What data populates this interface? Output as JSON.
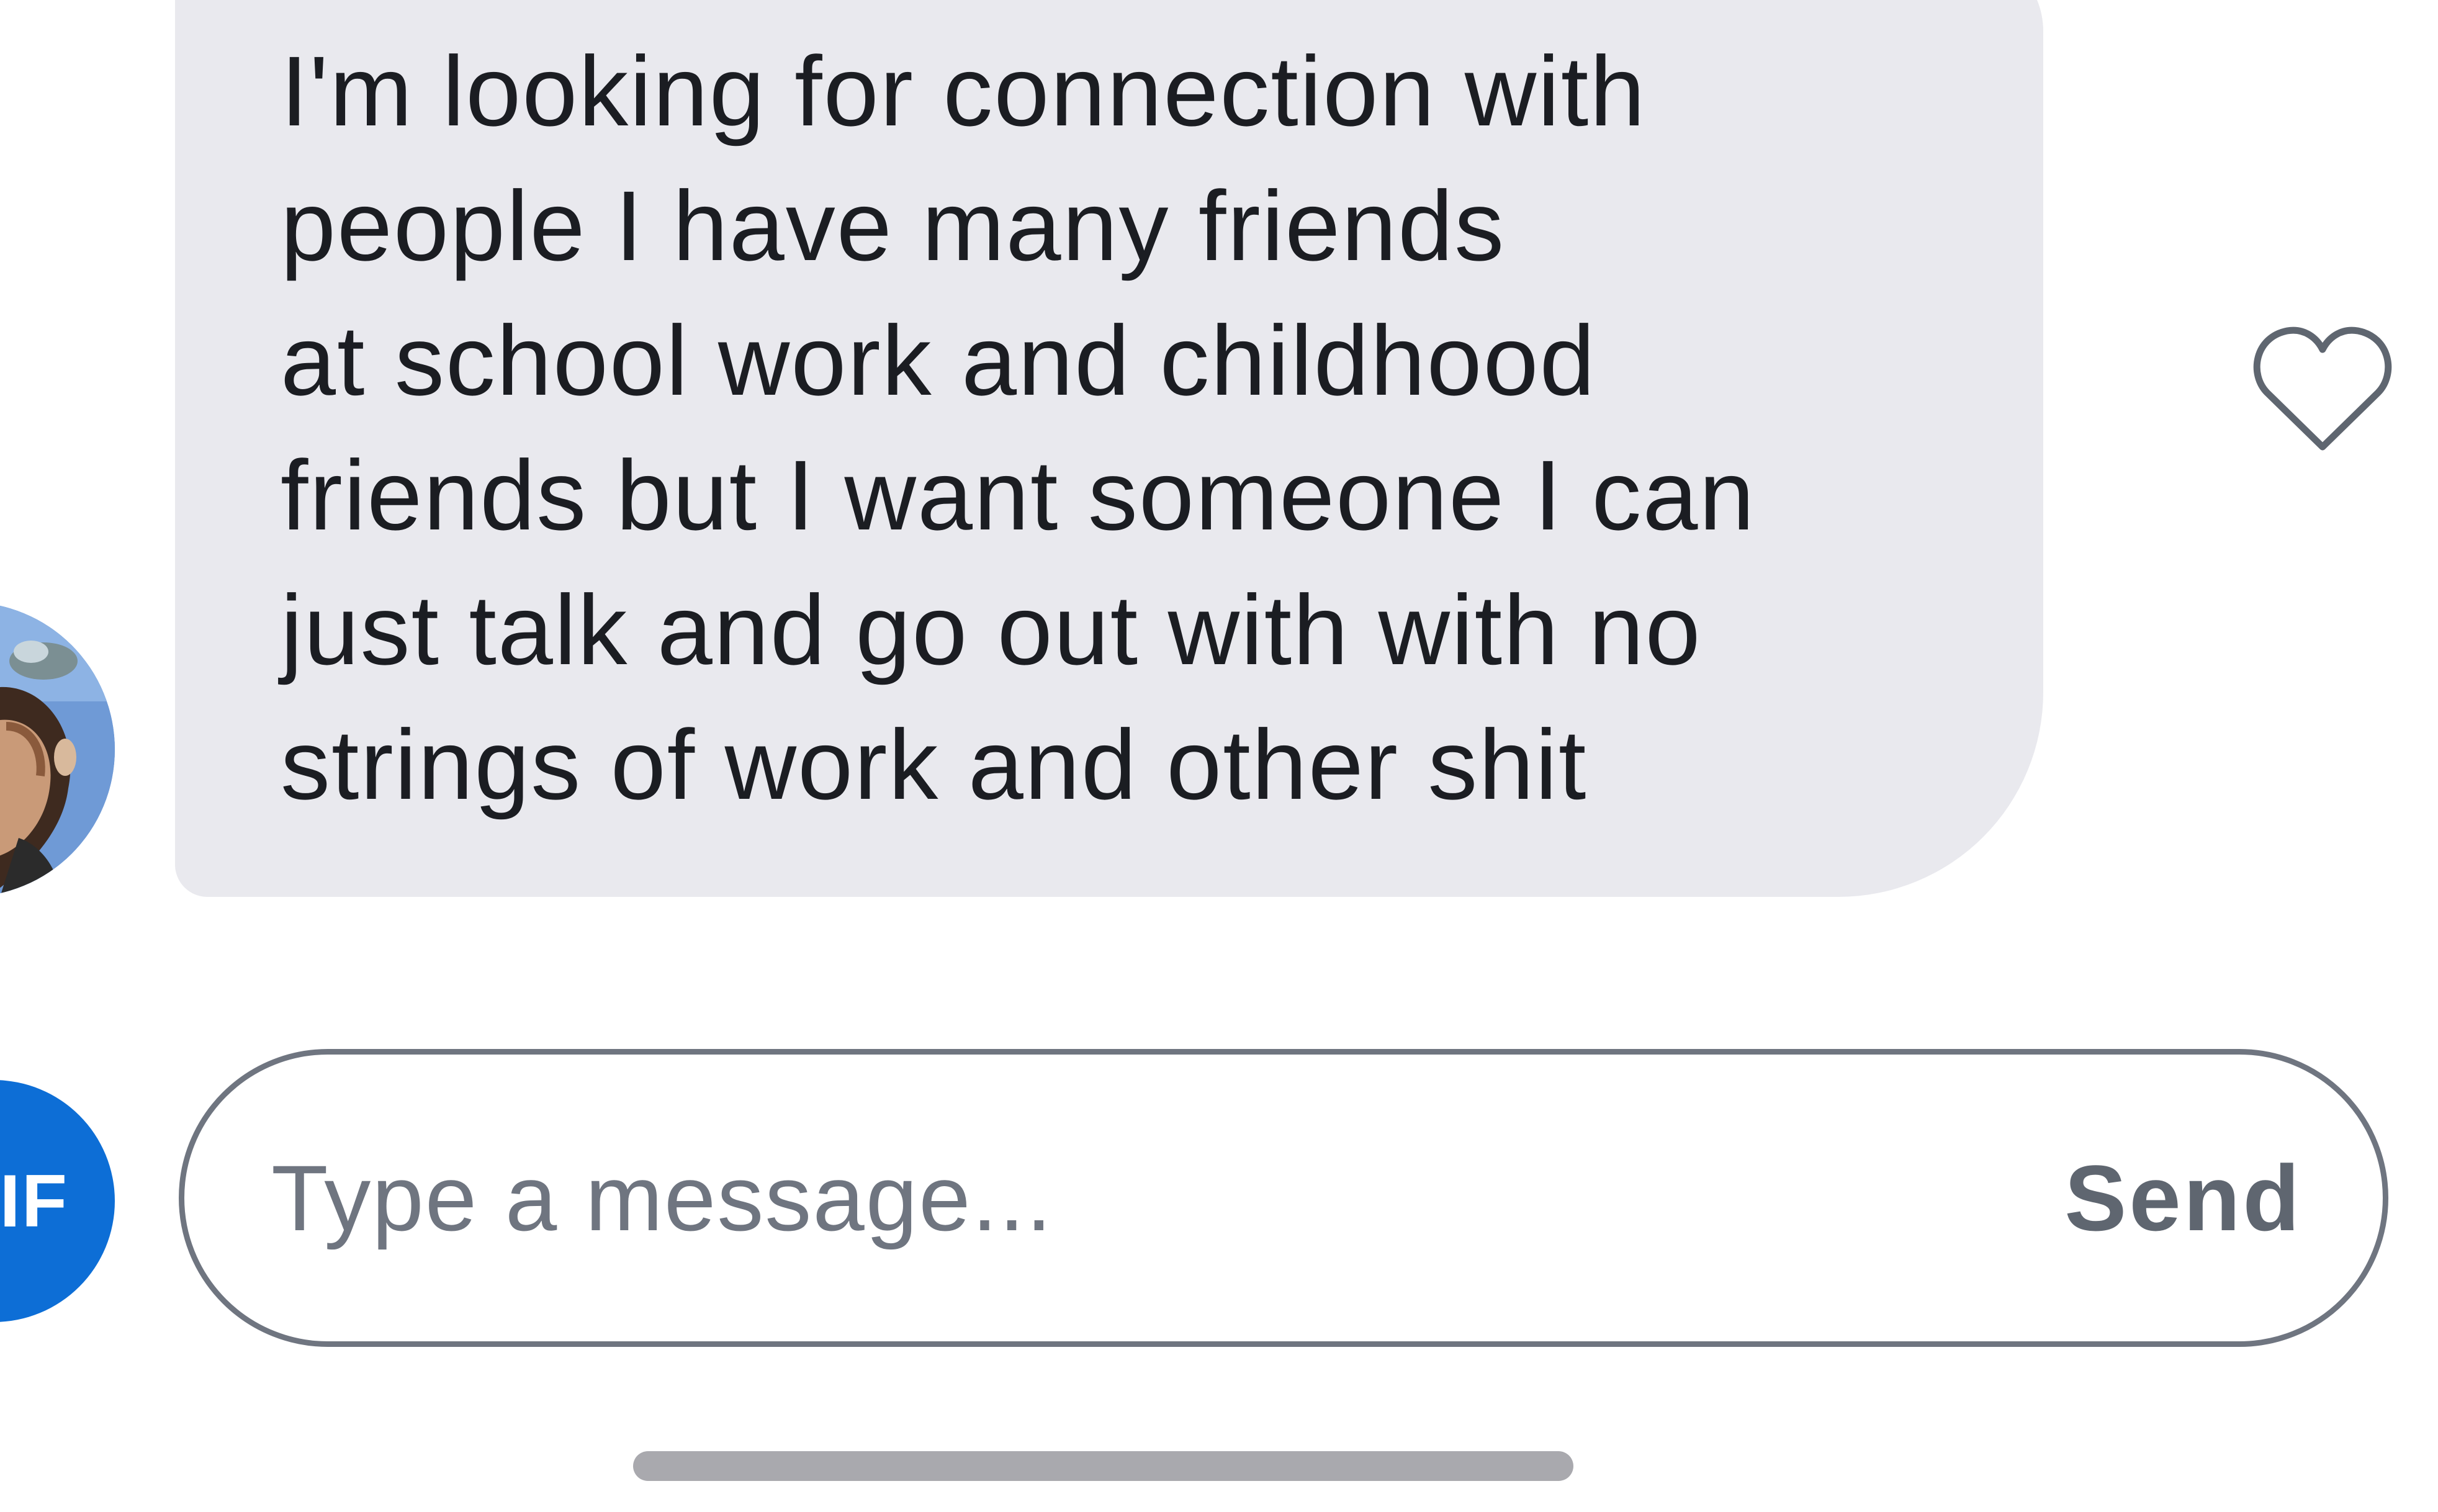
{
  "message": {
    "lines": [
      "I'm looking for connection with",
      "people I have many friends",
      "at school work and childhood",
      "friends but I want someone I can",
      "just talk and go out with with no",
      "strings of work and other shit"
    ],
    "bubble_color": "#e9e9ee",
    "text_color": "#1b1d22"
  },
  "like_button": {
    "icon": "heart-outline-icon",
    "liked": false
  },
  "avatar": {
    "icon": "profile-photo"
  },
  "composer": {
    "gif_label": "IF",
    "gif_color": "#0d6ed6",
    "placeholder": "Type a message...",
    "value": "",
    "send_label": "Send",
    "border_color": "#6f7580"
  }
}
